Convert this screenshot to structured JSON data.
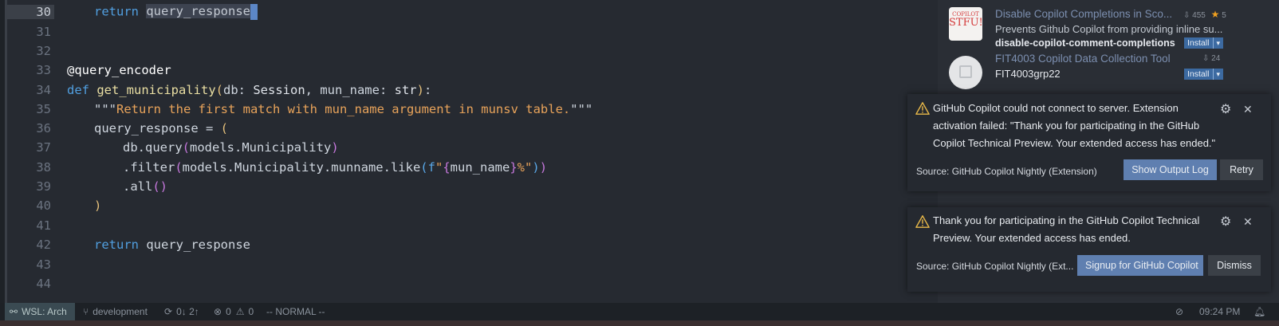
{
  "editor": {
    "lines": [
      {
        "num": "30",
        "current": true
      },
      {
        "num": "31"
      },
      {
        "num": "32"
      },
      {
        "num": "33"
      },
      {
        "num": "34"
      },
      {
        "num": "35"
      },
      {
        "num": "36"
      },
      {
        "num": "37"
      },
      {
        "num": "38"
      },
      {
        "num": "39"
      },
      {
        "num": "40"
      },
      {
        "num": "41"
      },
      {
        "num": "42"
      },
      {
        "num": "43"
      },
      {
        "num": "44"
      }
    ],
    "code": {
      "l30_kw": "return",
      "l30_sel": "query_response",
      "l33": "@query_encoder",
      "l34_def": "def",
      "l34_fn": "get_municipality",
      "l34_open": "(",
      "l34_p1": "db: ",
      "l34_t1": "Session",
      "l34_p2": ", mun_name: ",
      "l34_t2": "str",
      "l34_close": ")",
      "l34_colon": ":",
      "l35_q": "\"\"\"",
      "l35_doc": "Return the first match with mun_name argument in munsv table.",
      "l35_q2": "\"\"\"",
      "l36_var": "query_response = ",
      "l36_open": "(",
      "l37_a": "db.query",
      "l37_open": "(",
      "l37_b": "models.Municipality",
      "l37_close": ")",
      "l38_a": ".filter",
      "l38_open": "(",
      "l38_b": "models.Municipality.munname.like",
      "l38_open2": "(",
      "l38_f": "f",
      "l38_s1": "\"",
      "l38_br1": "{",
      "l38_var": "mun_name",
      "l38_br2": "}",
      "l38_s2": "%\"",
      "l38_close2": ")",
      "l38_close": ")",
      "l39_a": ".all",
      "l39_p": "()",
      "l40": ")",
      "l42_kw": "return",
      "l42_var": " query_response"
    }
  },
  "extensions": [
    {
      "title": "Disable Copilot Completions in Sco...",
      "downloads": "455",
      "rating": "5",
      "description": "Prevents Github Copilot from providing inline su...",
      "publisher": "disable-copilot-comment-completions",
      "install_label": "Install",
      "thumb_text_1": "COPILOT",
      "thumb_text_2": "STFU!"
    },
    {
      "title": "FIT4003 Copilot Data Collection Tool",
      "downloads": "24",
      "publisher": "FIT4003grp22",
      "install_label": "Install"
    }
  ],
  "notifications": [
    {
      "message": "GitHub Copilot could not connect to server. Extension activation failed: \"Thank you for participating in the GitHub Copilot Technical Preview. Your extended access has ended.\"",
      "source": "Source: GitHub Copilot Nightly (Extension)",
      "primary_button": "Show Output Log",
      "secondary_button": "Retry"
    },
    {
      "message": "Thank you for participating in the GitHub Copilot Technical Preview. Your extended access has ended.",
      "source": "Source: GitHub Copilot Nightly (Ext...",
      "primary_button": "Signup for GitHub Copilot",
      "secondary_button": "Dismiss"
    }
  ],
  "statusbar": {
    "remote": "WSL: Arch",
    "branch": "development",
    "sync": "0↓ 2↑",
    "errors": "0",
    "warnings": "0",
    "mode": "-- NORMAL --",
    "time": "09:24 PM"
  },
  "colors": {
    "accent": "#5f7fb0",
    "warning": "#e9b949",
    "star": "#f0a020"
  }
}
